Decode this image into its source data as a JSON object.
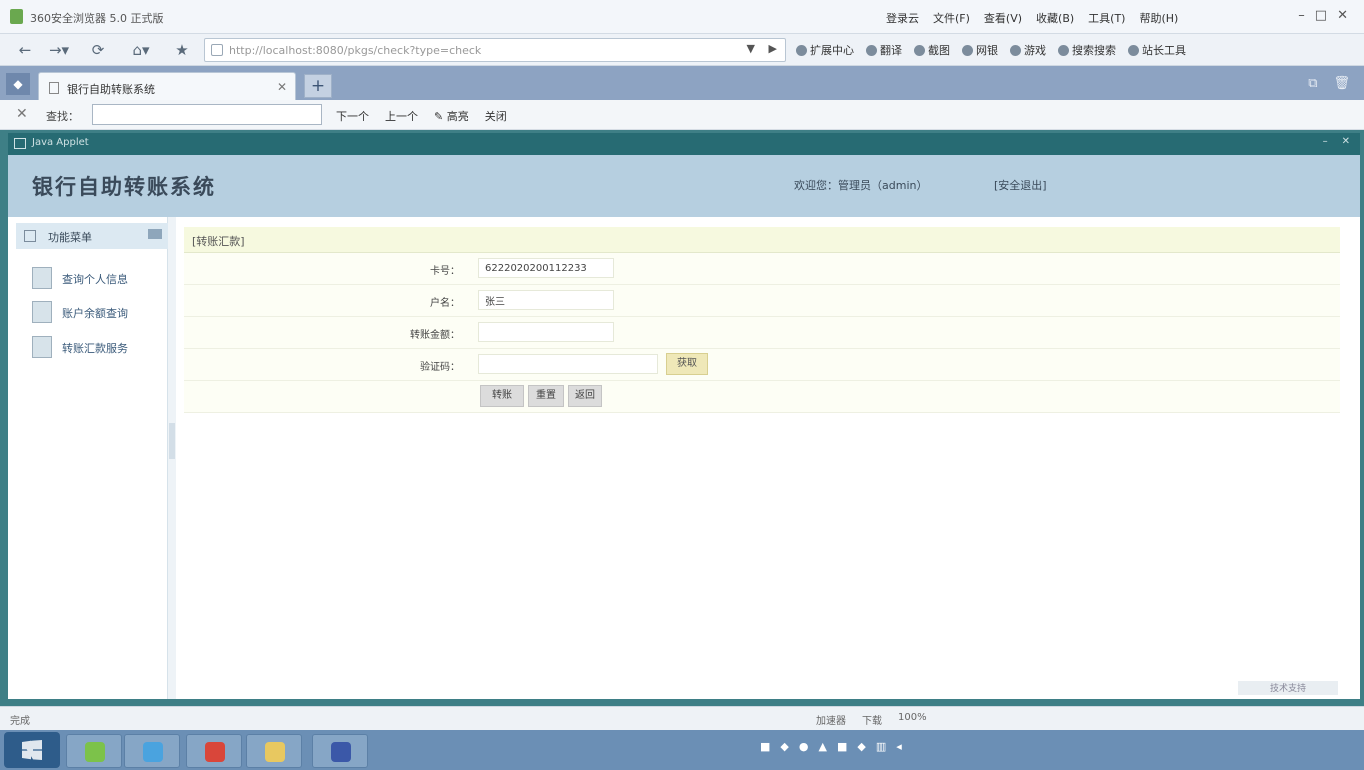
{
  "browser": {
    "title": "360安全浏览器 5.0 正式版",
    "menu": [
      "登录云",
      "文件(F)",
      "查看(V)",
      "收藏(B)",
      "工具(T)",
      "帮助(H)"
    ],
    "url": "http://localhost:8080/pkgs/check?type=check",
    "toolbar": [
      "扩展中心",
      "翻译",
      "截图",
      "网银",
      "游戏",
      "搜索搜索",
      "站长工具"
    ],
    "tab_label": "银行自助转账系统",
    "new_tab_symbol": "+"
  },
  "findbar": {
    "label": "查找：",
    "value": "",
    "next": "下一个",
    "prev": "上一个",
    "highlight": "高亮",
    "close_text": "关闭"
  },
  "app": {
    "window_title": "Java Applet",
    "name": "银行自助转账系统",
    "user_info": "欢迎您：管理员（admin）",
    "logout": "[安全退出]",
    "sidebar": {
      "header": "功能菜单",
      "items": [
        {
          "label": "查询个人信息"
        },
        {
          "label": "账户余额查询"
        },
        {
          "label": "转账汇款服务"
        }
      ]
    },
    "form": {
      "title": "[转账汇款]",
      "rows": [
        {
          "label": "卡号：",
          "value": "6222020200112233"
        },
        {
          "label": "户名：",
          "value": "张三"
        },
        {
          "label": "转账金额：",
          "value": ""
        },
        {
          "label": "验证码：",
          "value": "",
          "button": "获取"
        }
      ],
      "actions": [
        "转账",
        "重置",
        "返回"
      ]
    },
    "corner_note": "技术支持"
  },
  "statusbar": {
    "left": "完成",
    "items": [
      "加速器",
      "下载",
      "100%"
    ]
  },
  "taskbar": {
    "clock_time": "",
    "clock_date": ""
  }
}
